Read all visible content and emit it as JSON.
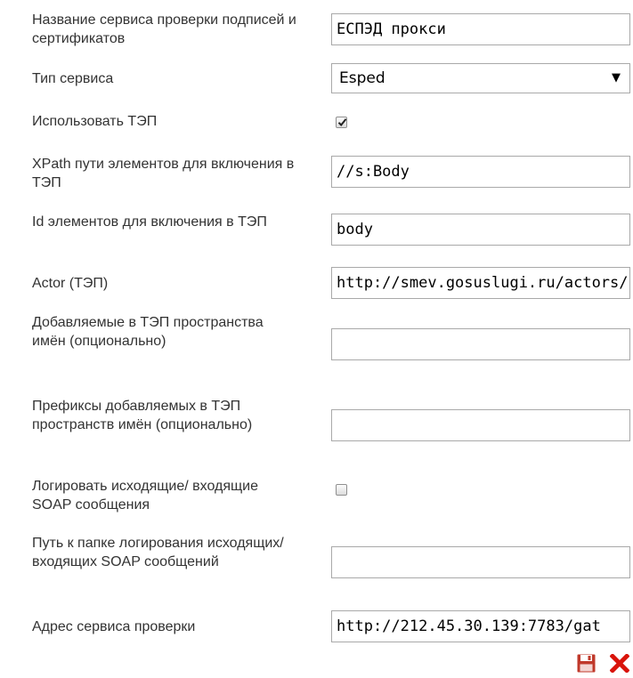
{
  "form": {
    "service_name": {
      "label": "Название сервиса проверки подписей и сертификатов",
      "value": "ЕСПЭД прокси"
    },
    "service_type": {
      "label": "Тип сервиса",
      "selected": "Esped"
    },
    "use_tep": {
      "label": "Использовать ТЭП",
      "checked": true
    },
    "xpath": {
      "label": "XPath пути элементов для включения в ТЭП",
      "value": "//s:Body"
    },
    "element_ids": {
      "label": "Id элементов для включения в ТЭП",
      "value": "body"
    },
    "actor": {
      "label": "Actor (ТЭП)",
      "value": "http://smev.gosuslugi.ru/actors/smev"
    },
    "namespaces": {
      "label": "Добавляемые в ТЭП пространства имён (опционально)",
      "value": ""
    },
    "namespace_prefixes": {
      "label": "Префиксы добавляемых в ТЭП пространств имён (опционально)",
      "value": ""
    },
    "log_soap": {
      "label": "Логировать исходящие/ входящие SOAP сообщения",
      "checked": false
    },
    "log_path": {
      "label": "Путь к папке логирования исходящих/входящих SOAP сообщений",
      "value": ""
    },
    "service_address": {
      "label": "Адрес сервиса проверки",
      "value": "http://212.45.30.139:7783/gat"
    }
  },
  "actions": {
    "save_icon": "floppy-disk-icon",
    "cancel_icon": "red-x-icon"
  },
  "colors": {
    "save": "#c0392b",
    "cancel": "#d9140b"
  }
}
